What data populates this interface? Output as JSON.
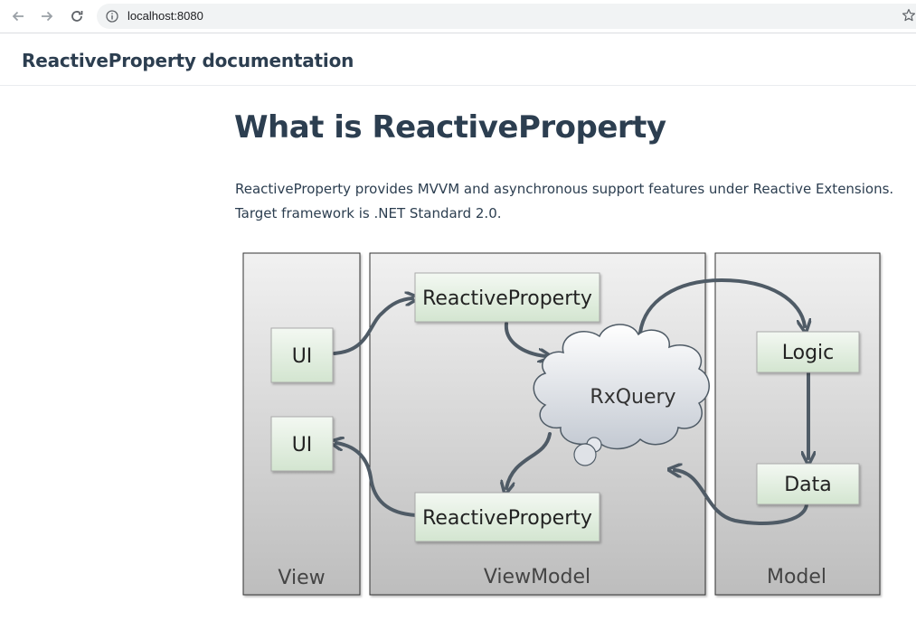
{
  "browser": {
    "url": "localhost:8080",
    "icons": [
      "back-arrow-icon",
      "forward-arrow-icon",
      "reload-icon",
      "info-icon",
      "star-icon"
    ]
  },
  "site": {
    "name": "ReactiveProperty documentation"
  },
  "content": {
    "title": "What is ReactiveProperty",
    "intro": "ReactiveProperty provides MVVM and asynchronous support features under Reactive Extensions. Target framework is .NET Standard 2.0."
  },
  "diagram": {
    "layers": {
      "view": "View",
      "viewmodel": "ViewModel",
      "model": "Model"
    },
    "nodes": {
      "ui_top": "UI",
      "ui_bottom": "UI",
      "rp_top": "ReactiveProperty",
      "rp_bottom": "ReactiveProperty",
      "rxquery": "RxQuery",
      "logic": "Logic",
      "data": "Data"
    },
    "colors": {
      "arrow": "#4f5b66",
      "node_top": "#f3f8f2",
      "node_bottom": "#d3e5d0",
      "panel_top": "#f1f1f1",
      "panel_bottom": "#bdbdbd"
    }
  }
}
